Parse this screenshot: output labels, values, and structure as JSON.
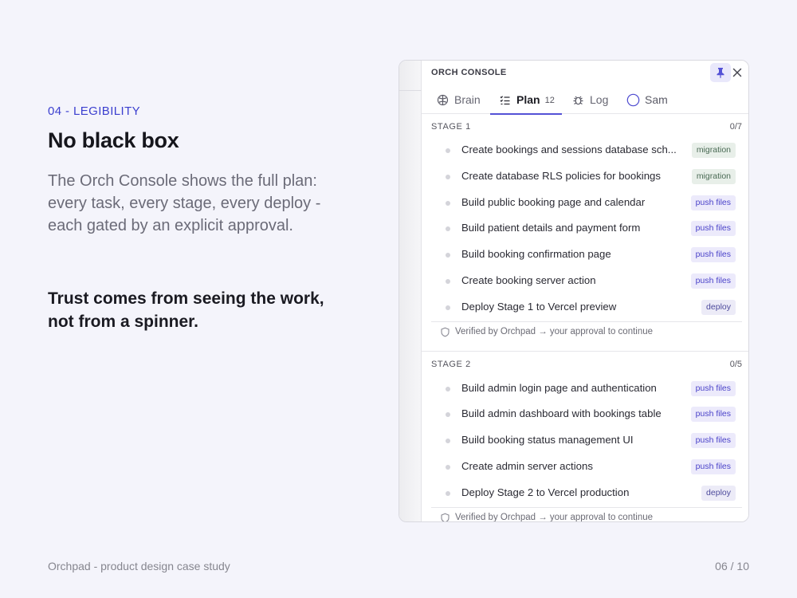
{
  "slide": {
    "eyebrow": "04 - LEGIBILITY",
    "headline": "No black box",
    "lead": "The Orch Console shows the full plan: every task, every stage, every deploy - each gated by an explicit approval.",
    "trust": "Trust comes from seeing the work, not from a spinner.",
    "footer_left": "Orchpad - product design case study",
    "footer_right": "06 / 10"
  },
  "console": {
    "title": "ORCH CONSOLE",
    "accent": "#5452d6",
    "tabs": [
      {
        "label": "Brain",
        "icon": "brain-icon"
      },
      {
        "label": "Plan",
        "icon": "list-icon",
        "count": "12",
        "active": true
      },
      {
        "label": "Log",
        "icon": "bug-icon"
      },
      {
        "label": "Sam",
        "icon": "circle-icon"
      }
    ],
    "stages": [
      {
        "label": "STAGE 1",
        "count": "0/7",
        "tasks": [
          {
            "name": "Create bookings and sessions database sch...",
            "badge": "migration"
          },
          {
            "name": "Create database RLS policies for bookings",
            "badge": "migration"
          },
          {
            "name": "Build public booking page and calendar",
            "badge": "push files"
          },
          {
            "name": "Build patient details and payment form",
            "badge": "push files"
          },
          {
            "name": "Build booking confirmation page",
            "badge": "push files"
          },
          {
            "name": "Create booking server action",
            "badge": "push files"
          },
          {
            "name": "Deploy Stage 1 to Vercel preview",
            "badge": "deploy"
          }
        ],
        "verify": "Verified by Orchpad → your approval to continue"
      },
      {
        "label": "STAGE 2",
        "count": "0/5",
        "tasks": [
          {
            "name": "Build admin login page and authentication",
            "badge": "push files"
          },
          {
            "name": "Build admin dashboard with bookings table",
            "badge": "push files"
          },
          {
            "name": "Build booking status management UI",
            "badge": "push files"
          },
          {
            "name": "Create admin server actions",
            "badge": "push files"
          },
          {
            "name": "Deploy Stage 2 to Vercel production",
            "badge": "deploy"
          }
        ],
        "verify": "Verified by Orchpad → your approval to continue"
      }
    ]
  }
}
